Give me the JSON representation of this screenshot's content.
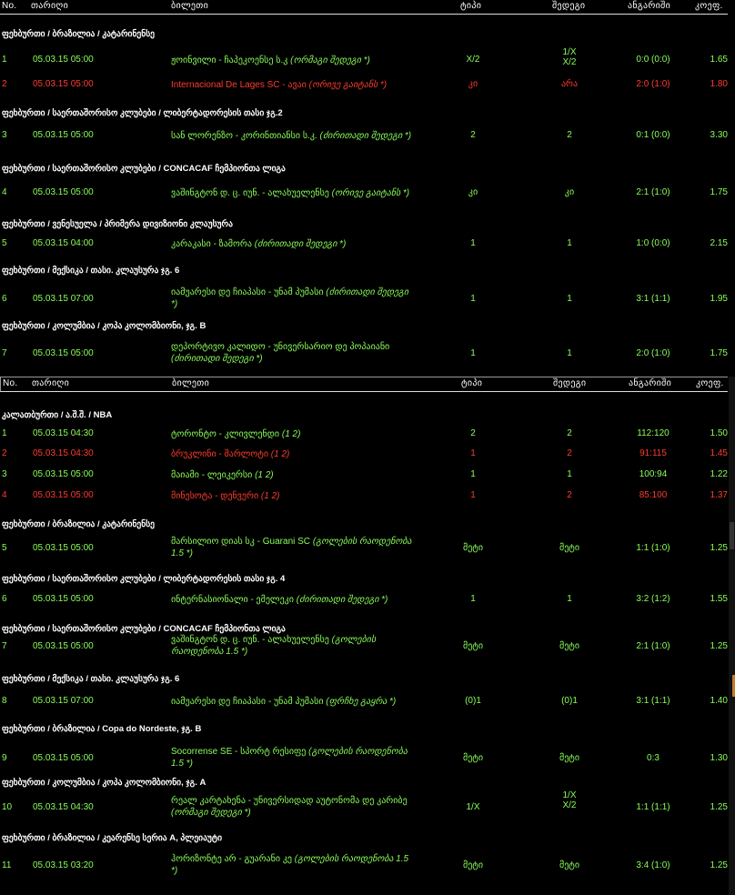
{
  "headers": {
    "no": "No.",
    "date": "თარიღი",
    "ticket": "ბილეთი",
    "type": "ტიპი",
    "outcome": "შედეგი",
    "score": "ანგარიში",
    "coef": "კოეფ."
  },
  "panel1": {
    "sections": [
      {
        "title": "ფეხბურთი / ბრაზილია / კატარინენსე",
        "rows": [
          {
            "no": "1",
            "date": "05.03.15 05:00",
            "ticket": "ჟოინვილი - ჩაპეკოენსე ს.კ",
            "note": "(ორმაგი შედეგი *)",
            "type": "X/2",
            "outcome": "1/X X/2",
            "score": "0:0 (0:0)",
            "coef": "1.65",
            "lost": false
          }
        ]
      },
      {
        "title": "",
        "rows": [
          {
            "no": "2",
            "date": "05.03.15 05:00",
            "ticket": "Internacional De Lages SC - ავაი",
            "note": "(ორივე გაიტანს *)",
            "type": "კი",
            "outcome": "არა",
            "score": "2:0 (1:0)",
            "coef": "1.80",
            "lost": true
          }
        ]
      },
      {
        "title": "ფეხბურთი / საერთაშორისო კლუბები / ლიბერტადორესის თასი ჯგ.2",
        "rows": [
          {
            "no": "3",
            "date": "05.03.15 05:00",
            "ticket": "სან ლორენზო - კორინთიანსი ს.კ.",
            "note": "(ძირითადი შედეგი *)",
            "type": "2",
            "outcome": "2",
            "score": "0:1 (0:0)",
            "coef": "3.30",
            "lost": false
          }
        ]
      },
      {
        "title": "ფეხბურთი / საერთაშორისო კლუბები / CONCACAF ჩემპიონთა ლიგა",
        "rows": [
          {
            "no": "4",
            "date": "05.03.15 05:00",
            "ticket": "ვაშინგტონ დ. ც. იუნ. - ალახუელენსე",
            "note": "(ორივე გაიტანს *)",
            "type": "კი",
            "outcome": "კი",
            "score": "2:1 (1:0)",
            "coef": "1.75",
            "lost": false
          }
        ]
      },
      {
        "title": "ფეხბურთი / ვენესუელა / პრიმერა დივიზიონი კლაუსურა",
        "rows": [
          {
            "no": "5",
            "date": "05.03.15 04:00",
            "ticket": "კარაკასი - ზამორა",
            "note": "(ძირითადი შედეგი *)",
            "type": "1",
            "outcome": "1",
            "score": "1:0 (0:0)",
            "coef": "2.15",
            "lost": false
          }
        ]
      },
      {
        "title": "ფეხბურთი / მექსიკა / თასი. კლაუსურა ჯგ. 6",
        "rows": [
          {
            "no": "6",
            "date": "05.03.15 07:00",
            "ticket": "იამუარესი დე ჩიაპასი - უნამ პუმასი",
            "note": "(ძირითადი შედეგი *)",
            "type": "1",
            "outcome": "1",
            "score": "3:1 (1:1)",
            "coef": "1.95",
            "lost": false
          }
        ]
      },
      {
        "title": "ფეხბურთი / კოლუმბია / კოპა კოლომბიონი, ჯგ. B",
        "rows": [
          {
            "no": "7",
            "date": "05.03.15 05:00",
            "ticket": "დეპორტივო კალიდო - უნივერსარიო დე პოპაიანი",
            "note": "(ძირითადი შედეგი *)",
            "type": "1",
            "outcome": "1",
            "score": "2:0 (1:0)",
            "coef": "1.75",
            "lost": false
          }
        ]
      }
    ]
  },
  "panel2": {
    "sections": [
      {
        "title": "კალათბურთი / ა.შ.შ. / NBA",
        "rows": [
          {
            "no": "1",
            "date": "05.03.15 04:30",
            "ticket": "ტორონტო - კლივლენდი",
            "note": "(1 2)",
            "type": "2",
            "outcome": "2",
            "score": "112:120",
            "coef": "1.50",
            "lost": false
          },
          {
            "no": "2",
            "date": "05.03.15 04:30",
            "ticket": "ბრუკლინი - შარლოტი",
            "note": "(1 2)",
            "type": "1",
            "outcome": "2",
            "score": "91:115",
            "coef": "1.45",
            "lost": true
          },
          {
            "no": "3",
            "date": "05.03.15 05:00",
            "ticket": "მაიამი - ლეიკერსი",
            "note": "(1 2)",
            "type": "1",
            "outcome": "1",
            "score": "100:94",
            "coef": "1.22",
            "lost": false
          },
          {
            "no": "4",
            "date": "05.03.15 05:00",
            "ticket": "მინესოტა - დენვერი",
            "note": "(1 2)",
            "type": "1",
            "outcome": "2",
            "score": "85:100",
            "coef": "1.37",
            "lost": true
          }
        ]
      },
      {
        "title": "ფეხბურთი / ბრაზილია / კატარინენსე",
        "rows": [
          {
            "no": "5",
            "date": "05.03.15 05:00",
            "ticket": "მარსილიო დიას სკ - Guarani SC",
            "note": "(გოლების რაოდენობა 1.5 *)",
            "type": "მეტი",
            "outcome": "მეტი",
            "score": "1:1 (1:0)",
            "coef": "1.25",
            "lost": false
          }
        ]
      },
      {
        "title": "ფეხბურთი / საერთაშორისო კლუბები / ლიბერტადორესის თასი ჯგ. 4",
        "rows": [
          {
            "no": "6",
            "date": "05.03.15 05:00",
            "ticket": "ინტერნასიონალი - ემელეკი",
            "note": "(ძირითადი შედეგი *)",
            "type": "1",
            "outcome": "1",
            "score": "3:2 (1:2)",
            "coef": "1.55",
            "lost": false
          }
        ]
      },
      {
        "title": "ფეხბურთი / საერთაშორისო კლუბები / CONCACAF ჩემპიონთა ლიგა",
        "rows": [
          {
            "no": "7",
            "date": "05.03.15 05:00",
            "ticket": "ვაშინგტონ დ. ც. იუნ. - ალახუელენსე",
            "note": "(გოლების რაოდენობა 1.5 *)",
            "type": "მეტი",
            "outcome": "მეტი",
            "score": "2:1 (1:0)",
            "coef": "1.25",
            "lost": false
          }
        ]
      },
      {
        "title": "ფეხბურთი / მექსიკა / თასი. კლაუსურა ჯგ. 6",
        "rows": [
          {
            "no": "8",
            "date": "05.03.15 07:00",
            "ticket": "იამუარესი დე ჩიაპასი - უნამ პუმასი",
            "note": "(ფრჩხე გაყრა *)",
            "type": "(0)1",
            "outcome": "(0)1",
            "score": "3:1 (1:1)",
            "coef": "1.40",
            "lost": false
          }
        ]
      },
      {
        "title": "ფეხბურთი / ბრაზილია / Copa do Nordeste, ჯგ. B",
        "rows": [
          {
            "no": "9",
            "date": "05.03.15 05:00",
            "ticket": "Socorrense SE - სპორტ რესიფე",
            "note": "(გოლების რაოდენობა 1.5 *)",
            "type": "მეტი",
            "outcome": "მეტი",
            "score": "0:3",
            "coef": "1.30",
            "lost": false
          }
        ]
      },
      {
        "title": "ფეხბურთი / კოლუმბია / კოპა კოლომბიონი, ჯგ. A",
        "rows": [
          {
            "no": "10",
            "date": "05.03.15 04:30",
            "ticket": "რეალ კარტახენა - უნივერსიდად აუტონომა დე კარიბე",
            "note": "(ორმაგი შედეგი *)",
            "type": "1/X",
            "outcome": "1/X X/2",
            "score": "1:1 (1:1)",
            "coef": "1.25",
            "lost": false
          }
        ]
      },
      {
        "title": "ფეხბურთი / ბრაზილია / კეარენსე სერია A, პლეიაუტი",
        "rows": [
          {
            "no": "11",
            "date": "05.03.15 03:20",
            "ticket": "ჰორიზონტე არ - გუარანი კე",
            "note": "(გოლების რაოდენობა 1.5 *)",
            "type": "მეტი",
            "outcome": "მეტი",
            "score": "3:4 (1:0)",
            "coef": "1.25",
            "lost": false
          }
        ]
      }
    ]
  },
  "colors": {
    "win": "#8bff5a",
    "lost": "#ff3b2f",
    "background": "#000000"
  }
}
